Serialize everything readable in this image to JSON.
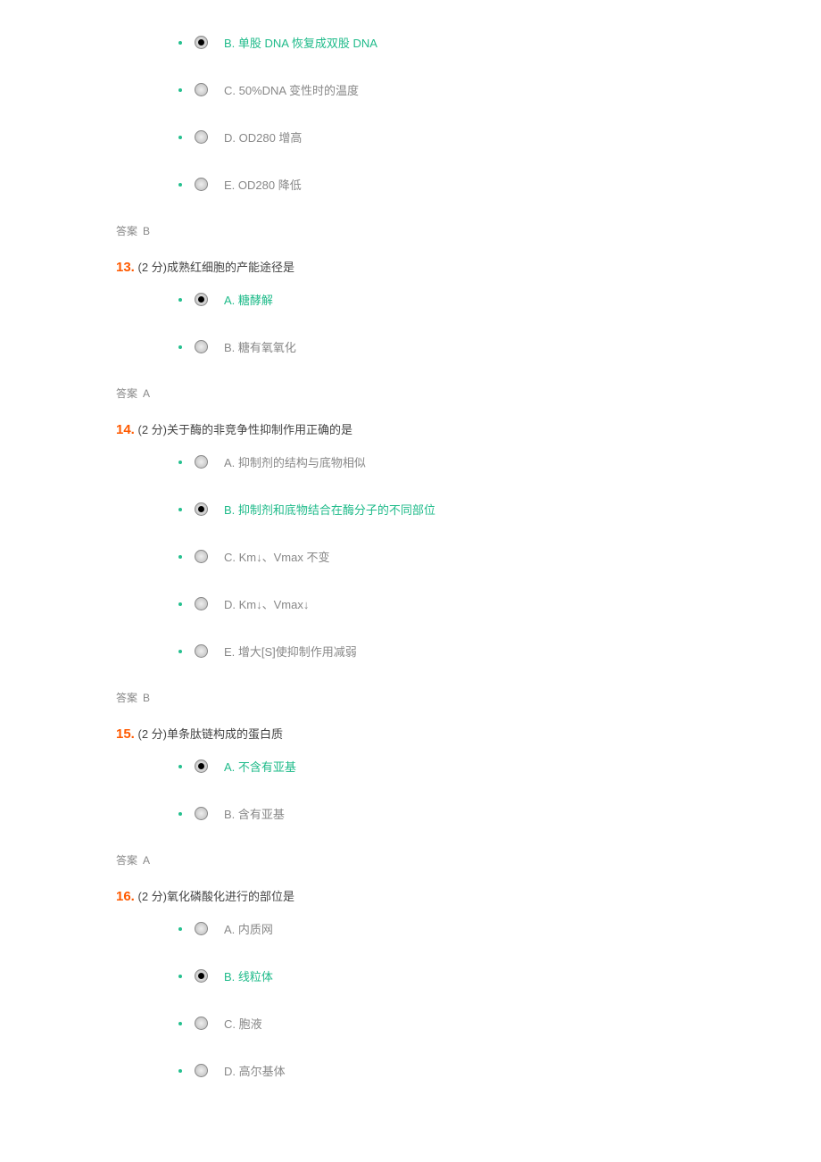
{
  "answer_label": "答案",
  "questions": [
    {
      "num": "",
      "points": "",
      "text": "",
      "answer": "B",
      "options": [
        {
          "label": "B.  单股 DNA 恢复成双股 DNA",
          "selected": true,
          "correct": true
        },
        {
          "label": "C. 50%DNA 变性时的温度",
          "selected": false,
          "correct": false
        },
        {
          "label": "D. OD280 增高",
          "selected": false,
          "correct": false
        },
        {
          "label": "E. OD280 降低",
          "selected": false,
          "correct": false
        }
      ]
    },
    {
      "num": "13.",
      "points": "(2 分)",
      "text": "成熟红细胞的产能途径是",
      "answer": "A",
      "options": [
        {
          "label": "A.  糖酵解",
          "selected": true,
          "correct": true
        },
        {
          "label": "B.  糖有氧氧化",
          "selected": false,
          "correct": false
        }
      ]
    },
    {
      "num": "14.",
      "points": "(2 分)",
      "text": "关于酶的非竞争性抑制作用正确的是",
      "answer": "B",
      "options": [
        {
          "label": "A.  抑制剂的结构与底物相似",
          "selected": false,
          "correct": false
        },
        {
          "label": "B.  抑制剂和底物结合在酶分子的不同部位",
          "selected": true,
          "correct": true
        },
        {
          "label": "C. Km↓、Vmax 不变",
          "selected": false,
          "correct": false
        },
        {
          "label": "D. Km↓、Vmax↓",
          "selected": false,
          "correct": false
        },
        {
          "label": "E.  增大[S]使抑制作用减弱",
          "selected": false,
          "correct": false
        }
      ]
    },
    {
      "num": "15.",
      "points": "(2 分)",
      "text": "单条肽链构成的蛋白质",
      "answer": "A",
      "options": [
        {
          "label": "A.  不含有亚基",
          "selected": true,
          "correct": true
        },
        {
          "label": "B.  含有亚基",
          "selected": false,
          "correct": false
        }
      ]
    },
    {
      "num": "16.",
      "points": "(2 分)",
      "text": "氧化磷酸化进行的部位是",
      "answer": "",
      "options": [
        {
          "label": "A.  内质网",
          "selected": false,
          "correct": false
        },
        {
          "label": "B.  线粒体",
          "selected": true,
          "correct": true
        },
        {
          "label": "C.  胞液",
          "selected": false,
          "correct": false
        },
        {
          "label": "D.  高尔基体",
          "selected": false,
          "correct": false
        }
      ]
    }
  ]
}
